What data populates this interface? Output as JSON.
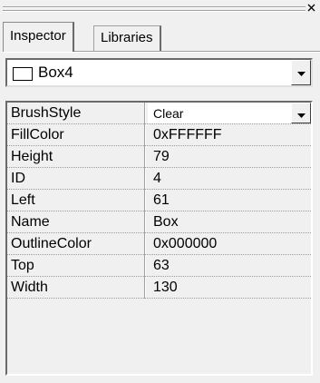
{
  "window": {
    "close_glyph": "x"
  },
  "tabs": [
    {
      "label": "Inspector",
      "active": true
    },
    {
      "label": "Libraries",
      "active": false
    }
  ],
  "object_selector": {
    "value": "Box4"
  },
  "properties": [
    {
      "name": "BrushStyle",
      "value": "Clear",
      "dropdown": true
    },
    {
      "name": "FillColor",
      "value": "0xFFFFFF"
    },
    {
      "name": "Height",
      "value": "79"
    },
    {
      "name": "ID",
      "value": "4"
    },
    {
      "name": "Left",
      "value": "61"
    },
    {
      "name": "Name",
      "value": "Box"
    },
    {
      "name": "OutlineColor",
      "value": "0x000000"
    },
    {
      "name": "Top",
      "value": "63"
    },
    {
      "name": "Width",
      "value": "130"
    }
  ],
  "icons": {
    "close": "close-icon",
    "dropdown": "chevron-down-icon",
    "swatch": "rectangle-shape-icon"
  }
}
